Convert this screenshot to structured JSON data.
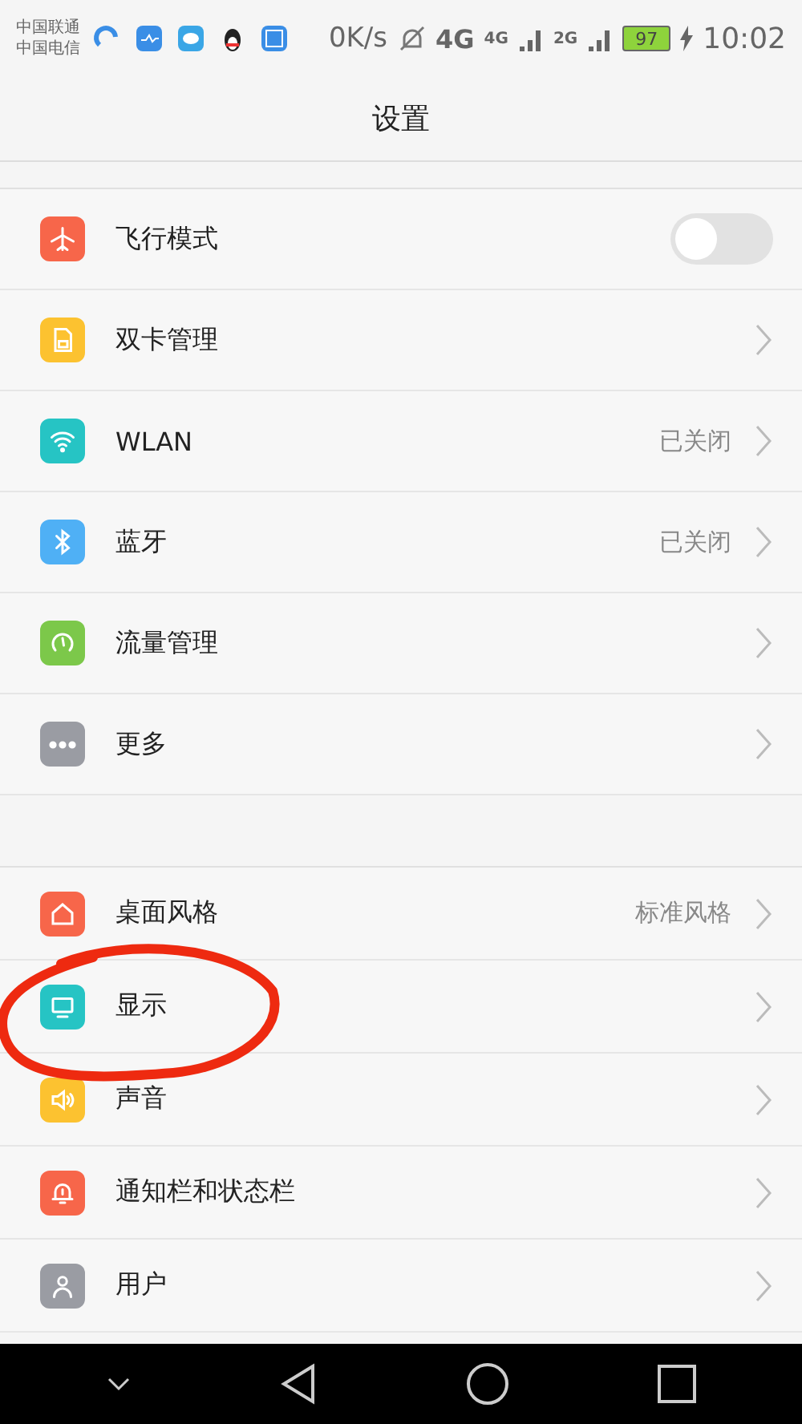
{
  "status_bar": {
    "carriers": [
      "中国联通",
      "中国电信"
    ],
    "speed": "0K/s",
    "network_1": "4G",
    "network_2": "4G",
    "network_3": "2G",
    "battery": "97",
    "charging": true,
    "time": "10:02"
  },
  "title": "设置",
  "sections": [
    {
      "items": [
        {
          "kind": "toggle",
          "color": "#f7664a",
          "label": "飞行模式",
          "on": false,
          "circled": false
        },
        {
          "kind": "link",
          "color": "#fcc230",
          "label": "双卡管理",
          "circled": false
        },
        {
          "kind": "link",
          "color": "#26c4c4",
          "label": "WLAN",
          "value": "已关闭",
          "circled": false
        },
        {
          "kind": "link",
          "color": "#4fb0f5",
          "label": "蓝牙",
          "value": "已关闭",
          "circled": false
        },
        {
          "kind": "link",
          "color": "#7cc84a",
          "label": "流量管理",
          "circled": false
        },
        {
          "kind": "link",
          "color": "#9a9ca3",
          "label": "更多",
          "circled": false
        }
      ]
    },
    {
      "items": [
        {
          "kind": "link",
          "color": "#f7664a",
          "label": "桌面风格",
          "value": "标准风格",
          "circled": false
        },
        {
          "kind": "link",
          "color": "#26c4c4",
          "label": "显示",
          "circled": true
        },
        {
          "kind": "link",
          "color": "#fcc230",
          "label": "声音",
          "circled": false
        },
        {
          "kind": "link",
          "color": "#f7664a",
          "label": "通知栏和状态栏",
          "circled": false
        },
        {
          "kind": "link",
          "color": "#9a9ca3",
          "label": "用户",
          "circled": false
        }
      ]
    }
  ]
}
